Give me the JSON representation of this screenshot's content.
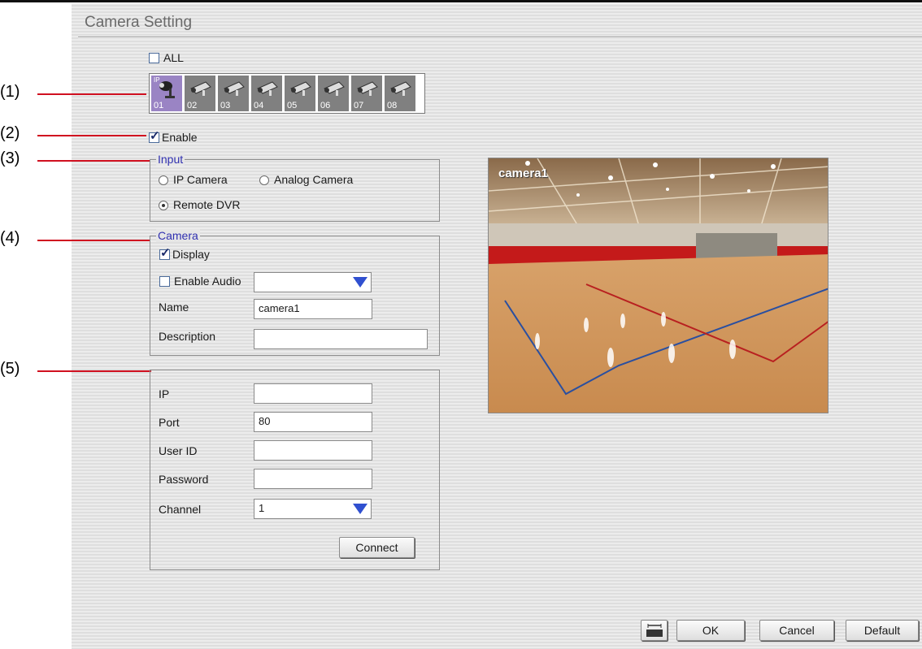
{
  "window": {
    "title": "Camera Setting"
  },
  "callouts": [
    "(1)",
    "(2)",
    "(3)",
    "(4)",
    "(5)"
  ],
  "all_checkbox": {
    "label": "ALL",
    "checked": false
  },
  "cameras": [
    {
      "num": "01",
      "type": "IP",
      "selected": true
    },
    {
      "num": "02"
    },
    {
      "num": "03"
    },
    {
      "num": "04"
    },
    {
      "num": "05"
    },
    {
      "num": "06"
    },
    {
      "num": "07"
    },
    {
      "num": "08"
    }
  ],
  "enable_checkbox": {
    "label": "Enable",
    "checked": true
  },
  "input_group": {
    "legend": "Input",
    "options": [
      "IP Camera",
      "Analog Camera",
      "Remote DVR"
    ],
    "selected": "Remote DVR"
  },
  "camera_group": {
    "legend": "Camera",
    "display_label": "Display",
    "display_checked": true,
    "enable_audio_label": "Enable Audio",
    "enable_audio_checked": false,
    "audio_select_value": "",
    "name_label": "Name",
    "name_value": "camera1",
    "description_label": "Description",
    "description_value": ""
  },
  "connection_group": {
    "ip_label": "IP",
    "ip_value": "",
    "port_label": "Port",
    "port_value": "80",
    "userid_label": "User ID",
    "userid_value": "",
    "password_label": "Password",
    "password_value": "",
    "channel_label": "Channel",
    "channel_value": "1",
    "connect_label": "Connect"
  },
  "preview": {
    "label": "camera1"
  },
  "footer": {
    "ok_label": "OK",
    "cancel_label": "Cancel",
    "default_label": "Default"
  },
  "colors": {
    "callout_line": "#d01020",
    "legend_text": "#3030b0",
    "dropdown_arrow": "#3050d0",
    "selected_tile": "#9a84c4"
  }
}
